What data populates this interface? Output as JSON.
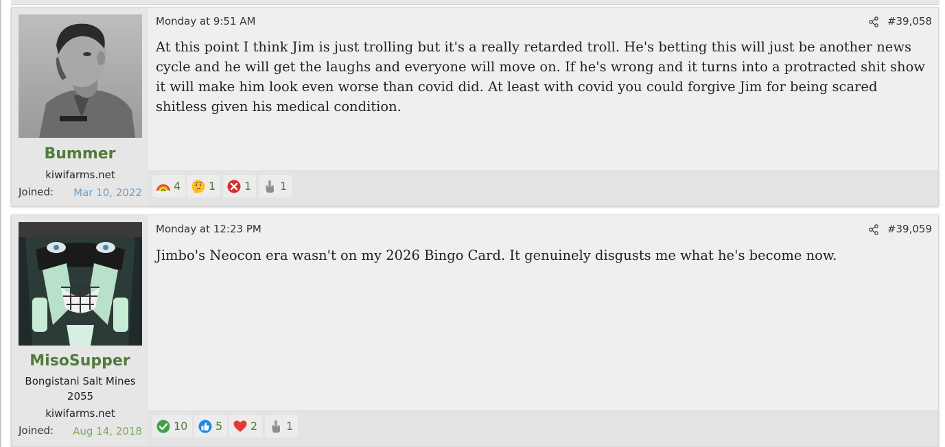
{
  "posts": [
    {
      "username": "Bummer",
      "user_title": "kiwifarms.net",
      "joined_label": "Joined:",
      "joined_date": "Mar 10, 2022",
      "date": "Monday at 9:51 AM",
      "post_number": "#39,058",
      "message": "At this point I think Jim is just trolling but it's a really retarded troll. He's betting this will just be another news cycle and he will get the laughs and everyone will move on. If he's wrong and it turns into a protracted shit show it will make him look even worse than covid did. At least with covid you could forgive Jim for being scared shitless given his medical condition.",
      "reactions": [
        {
          "icon": "rainbow-icon",
          "count": "4"
        },
        {
          "icon": "thinking-face-icon",
          "count": "1"
        },
        {
          "icon": "red-x-icon",
          "count": "1"
        },
        {
          "icon": "middle-finger-icon",
          "count": "1"
        }
      ]
    },
    {
      "username": "MisoSupper",
      "user_title_line1": "Bongistani Salt Mines",
      "user_title_line2": "2055",
      "site": "kiwifarms.net",
      "joined_label": "Joined:",
      "joined_date": "Aug 14, 2018",
      "date": "Monday at 12:23 PM",
      "post_number": "#39,059",
      "message": "Jimbo's Neocon era wasn't on my 2026 Bingo Card. It genuinely disgusts me what he's become now.",
      "reactions": [
        {
          "icon": "checkmark-icon",
          "count": "10"
        },
        {
          "icon": "thumbs-up-icon",
          "count": "5"
        },
        {
          "icon": "heart-icon",
          "count": "2"
        },
        {
          "icon": "middle-finger-icon",
          "count": "1"
        }
      ]
    }
  ],
  "colors": {
    "username": "#4f7c3a",
    "joined_date_1": "#6a9fc8",
    "joined_date_2": "#7ea85e",
    "post_bg": "#efefef",
    "user_cell_bg": "#e6e6e6"
  }
}
